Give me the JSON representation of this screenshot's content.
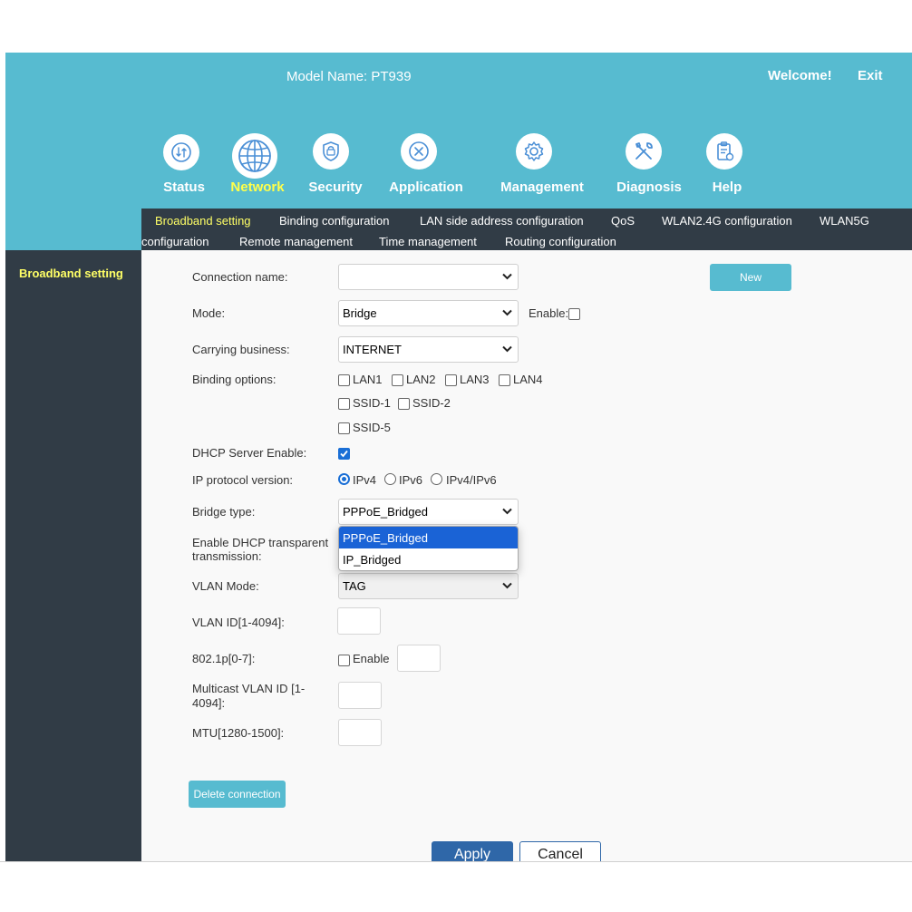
{
  "header": {
    "model_name": "Model Name: PT939",
    "welcome": "Welcome!",
    "exit": "Exit"
  },
  "nav": [
    {
      "label": "Status",
      "icon": "status-icon"
    },
    {
      "label": "Network",
      "icon": "globe-icon",
      "active": true
    },
    {
      "label": "Security",
      "icon": "shield-icon"
    },
    {
      "label": "Application",
      "icon": "application-icon"
    },
    {
      "label": "Management",
      "icon": "gear-icon"
    },
    {
      "label": "Diagnosis",
      "icon": "tools-icon"
    },
    {
      "label": "Help",
      "icon": "help-clipboard-icon"
    }
  ],
  "submenu": [
    "Broadband setting",
    "Binding configuration",
    "LAN side address configuration",
    "QoS",
    "WLAN2.4G configuration",
    "WLAN5G",
    "configuration",
    "Remote management",
    "Time management",
    "Routing configuration"
  ],
  "sidebar": {
    "item": "Broadband setting"
  },
  "form": {
    "connection_name_label": "Connection name:",
    "connection_name_value": "",
    "new_button": "New",
    "mode_label": "Mode:",
    "mode_value": "Bridge",
    "enable_label": "Enable:",
    "carrying_business_label": "Carrying business:",
    "carrying_business_value": "INTERNET",
    "binding_options_label": "Binding options:",
    "binding": {
      "lan1": "LAN1",
      "lan2": "LAN2",
      "lan3": "LAN3",
      "lan4": "LAN4",
      "ssid1": "SSID-1",
      "ssid2": "SSID-2",
      "ssid5": "SSID-5"
    },
    "dhcp_server_label": "DHCP Server Enable:",
    "ip_protocol_label": "IP protocol version:",
    "ip": {
      "ipv4": "IPv4",
      "ipv6": "IPv6",
      "ipv4v6": "IPv4/IPv6"
    },
    "bridge_type_label": "Bridge type:",
    "bridge_type_value": "PPPoE_Bridged",
    "dropdown_options": [
      "PPPoE_Bridged",
      "IP_Bridged"
    ],
    "dhcp_transparent_label_1": "Enable DHCP transparent",
    "dhcp_transparent_label_2": "transmission:",
    "vlan_mode_label": "VLAN Mode:",
    "vlan_mode_value": "TAG",
    "vlan_id_label": "VLAN ID[1-4094]:",
    "p8021_label": "802.1p[0-7]:",
    "p8021_enable": "Enable",
    "multicast_label_1": "Multicast VLAN ID [1-",
    "multicast_label_2": "4094]:",
    "mtu_label": "MTU[1280-1500]:",
    "delete_button": "Delete connection",
    "apply_button": "Apply",
    "cancel_button": "Cancel"
  },
  "colors": {
    "header": "#57bbd0",
    "dark": "#313c46",
    "active_text": "#ffff66",
    "primary_button": "#2f67a8",
    "accent": "#1a63d6"
  }
}
